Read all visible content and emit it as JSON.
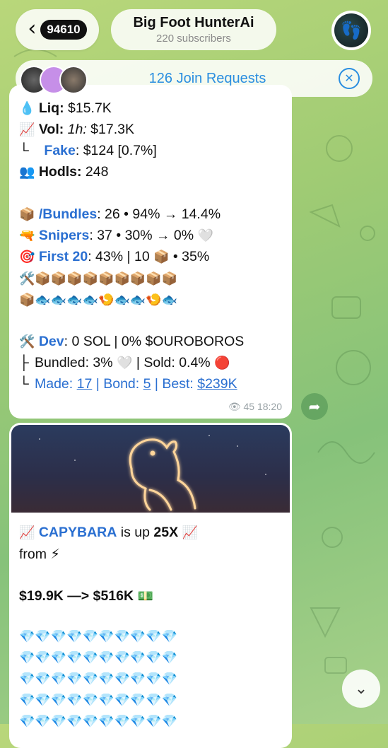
{
  "header": {
    "back_count": "94610",
    "channel_name": "Big Foot HunterAi",
    "subscribers": "220 subscribers",
    "avatar_glyph": "👣"
  },
  "join_bar": {
    "text": "126 Join Requests",
    "close_glyph": "✕"
  },
  "message1": {
    "liq_label": "Liq:",
    "liq_value": " $15.7K",
    "vol_label": "Vol:",
    "vol_period": " 1h:",
    "vol_value": " $17.3K",
    "fake_label": "Fake",
    "fake_value": ": $124 [0.7%]",
    "hodls_label": "Hodls:",
    "hodls_value": " 248",
    "bundles_label": "/Bundles",
    "bundles_value": ": 26 • 94% → 14.4%",
    "snipers_label": "Snipers",
    "snipers_value": ": 37 • 30% → 0% ",
    "first20_label": "First 20",
    "first20_value": ": 43% | 10 ",
    "first20_suffix": " • 35%",
    "emoji_row1": "🛠️📦📦📦📦📦📦📦📦📦",
    "emoji_row2": "📦🐟🐟🐟🐟🍤🐟🐟🍤🐟",
    "dev_label": "Dev",
    "dev_value": ": 0 SOL | 0% $OUROBOROS",
    "bundled_label": "Bundled: 3% ",
    "sold_label": " | Sold: 0.4% ",
    "made_label": "Made: ",
    "made_value": "17",
    "bond_label": " | Bond: ",
    "bond_value": "5",
    "best_label": " | Best: ",
    "best_value": "$239K",
    "views": "45",
    "time": "18:20"
  },
  "message2": {
    "token": "CAPYBARA",
    "is_up": " is up ",
    "multiple": "25X",
    "from": "from ⚡",
    "price_change": "$19.9K —> $516K",
    "diamonds": "💎💎💎💎💎💎💎💎💎💎"
  },
  "icons": {
    "back": "chevron-left-icon",
    "share": "share-arrow-icon",
    "scroll": "chevron-down-icon"
  }
}
